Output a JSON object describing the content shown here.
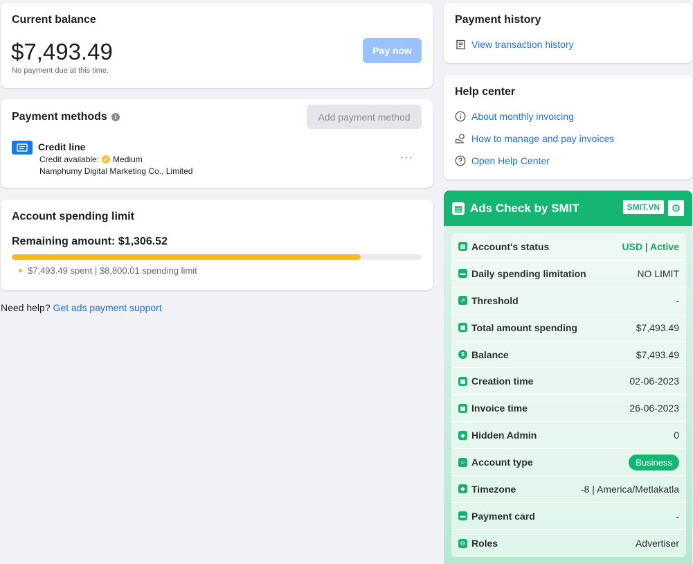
{
  "balance": {
    "title": "Current balance",
    "amount": "$7,493.49",
    "note": "No payment due at this time.",
    "pay_label": "Pay now"
  },
  "methods": {
    "title": "Payment methods",
    "add_label": "Add payment method",
    "item": {
      "name": "Credit line",
      "available_label": "Credit available:",
      "available_value": "Medium",
      "company": "Namphumy Digital Marketing Co., Limited",
      "more": "···"
    }
  },
  "limit": {
    "title": "Account spending limit",
    "remaining": "Remaining amount: $1,306.52",
    "progress_fraction": 0.8515,
    "note": "$7,493.49 spent | $8,800.01 spending limit"
  },
  "help_text": {
    "prefix": "Need help?",
    "link": "Get ads payment support"
  },
  "history": {
    "title": "Payment history",
    "link": "View transaction history"
  },
  "help_center": {
    "title": "Help center",
    "links": [
      "About monthly invoicing",
      "How to manage and pay invoices",
      "Open Help Center"
    ]
  },
  "smit": {
    "title": "Ads Check by SMIT",
    "badge": "SMIT.VN",
    "rows": [
      {
        "label": "Account's status",
        "value": "USD | Active"
      },
      {
        "label": "Daily spending limitation",
        "value": "NO LIMIT"
      },
      {
        "label": "Threshold",
        "value": "-"
      },
      {
        "label": "Total amount spending",
        "value": "$7,493.49"
      },
      {
        "label": "Balance",
        "value": "$7,493.49"
      },
      {
        "label": "Creation time",
        "value": "02-06-2023"
      },
      {
        "label": "Invoice time",
        "value": "26-06-2023"
      },
      {
        "label": "Hidden Admin",
        "value": "0"
      },
      {
        "label": "Account type",
        "value": "Business"
      },
      {
        "label": "Timezone",
        "value": "-8 | America/Metlakatla"
      },
      {
        "label": "Payment card",
        "value": "-"
      },
      {
        "label": "Roles",
        "value": "Advertiser"
      }
    ]
  },
  "colors": {
    "accent": "#216fdb",
    "progress": "#f7b928",
    "smit_green": "#15b672"
  }
}
